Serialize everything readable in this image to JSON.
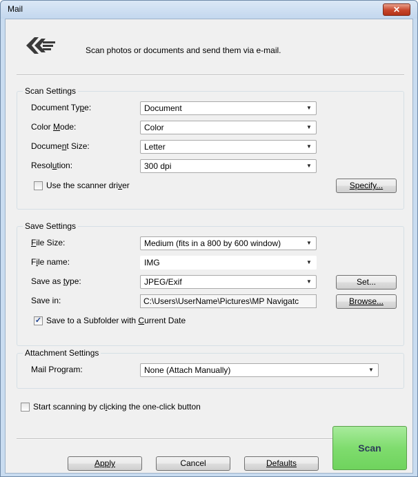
{
  "window": {
    "title": "Mail",
    "close_label": "✕"
  },
  "header": {
    "icon": "mail-scan-icon",
    "description": "Scan photos or documents and send them via e-mail."
  },
  "scan_settings": {
    "group_label": "Scan Settings",
    "document_type": {
      "label": "Document Type:",
      "value": "Document"
    },
    "color_mode": {
      "label": "Color Mode:",
      "value": "Color"
    },
    "document_size": {
      "label": "Document Size:",
      "value": "Letter"
    },
    "resolution": {
      "label": "Resolution:",
      "value": "300 dpi"
    },
    "use_driver": {
      "label": "Use the scanner driver",
      "checked": false
    },
    "specify_label": "Specify..."
  },
  "save_settings": {
    "group_label": "Save Settings",
    "file_size": {
      "label": "File Size:",
      "value": "Medium (fits in a 800 by 600 window)"
    },
    "file_name": {
      "label": "File name:",
      "value": "IMG"
    },
    "save_as_type": {
      "label": "Save as type:",
      "value": "JPEG/Exif"
    },
    "set_label": "Set...",
    "save_in": {
      "label": "Save in:",
      "value": "C:\\Users\\UserName\\Pictures\\MP Navigatc"
    },
    "browse_label": "Browse...",
    "subfolder": {
      "label": "Save to a Subfolder with Current Date",
      "checked": true
    }
  },
  "attachment_settings": {
    "group_label": "Attachment Settings",
    "mail_program": {
      "label": "Mail Program:",
      "value": "None (Attach Manually)"
    }
  },
  "one_click": {
    "label": "Start scanning by clicking the one-click button",
    "checked": false
  },
  "buttons": {
    "apply": "Apply",
    "cancel": "Cancel",
    "defaults": "Defaults",
    "scan": "Scan"
  },
  "colors": {
    "scan_button": "#7fdc6e",
    "close_button": "#c7452a",
    "title_bar": "#c3d7ee"
  }
}
